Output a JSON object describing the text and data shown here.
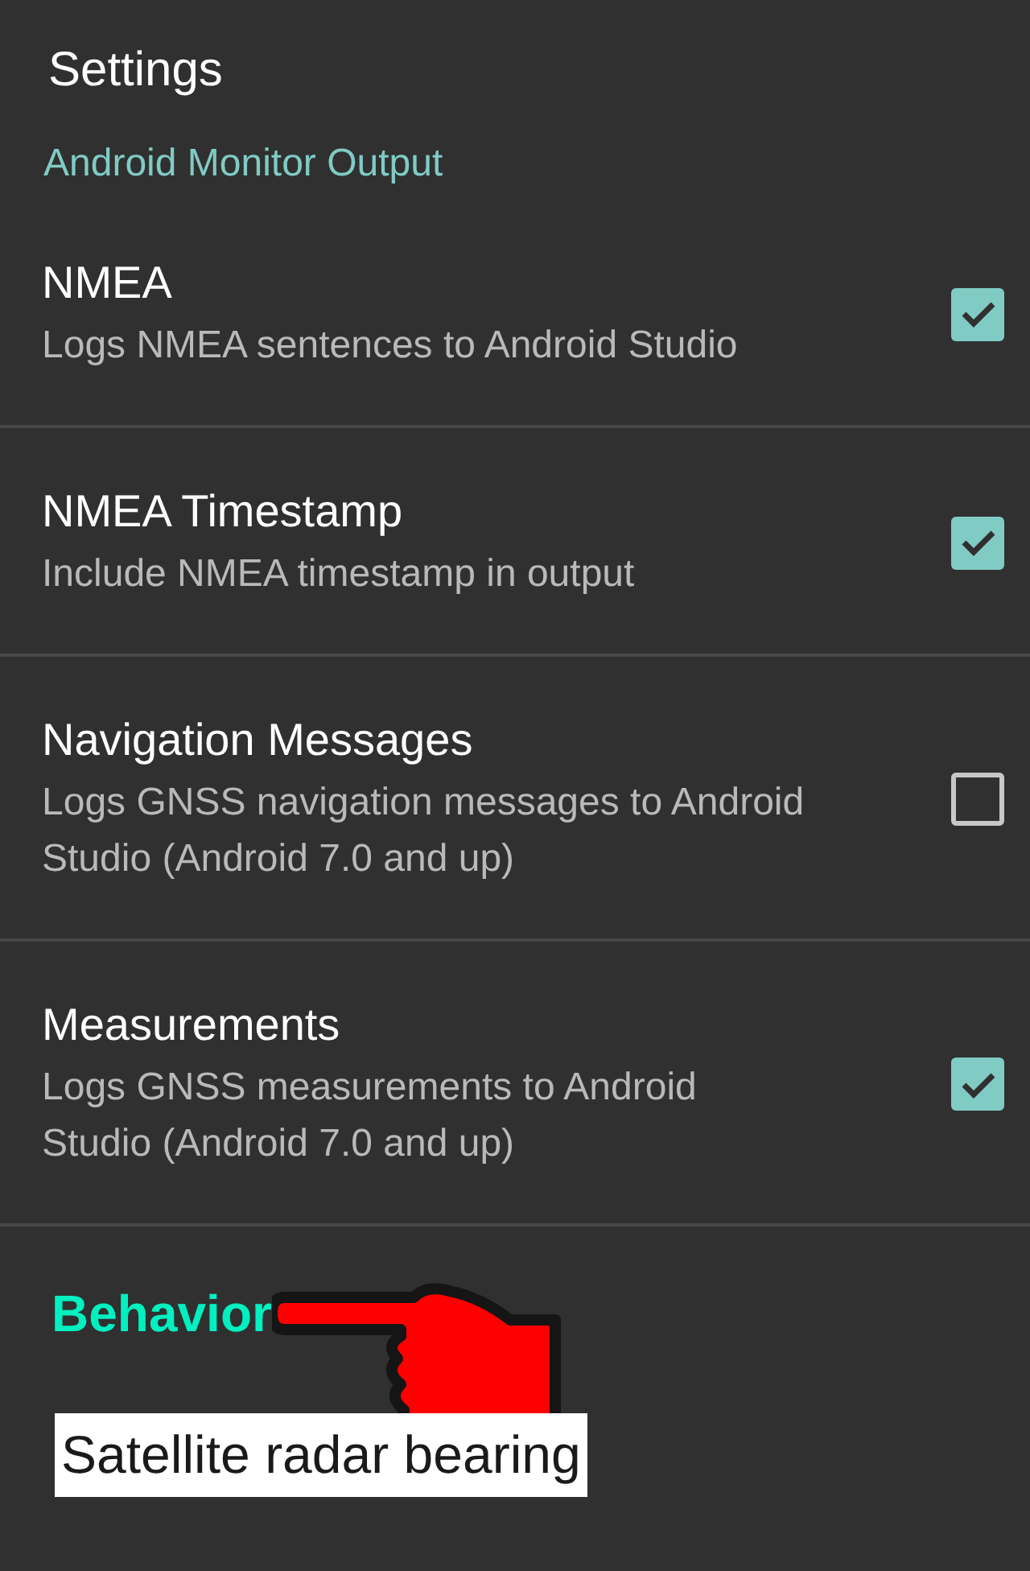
{
  "title": "Settings",
  "category": "Android Monitor Output",
  "preferences": [
    {
      "title": "NMEA",
      "summary": "Logs NMEA sentences to Android Studio",
      "checked": true
    },
    {
      "title": "NMEA Timestamp",
      "summary": "Include NMEA timestamp in output",
      "checked": true
    },
    {
      "title": "Navigation Messages",
      "summary": "Logs GNSS navigation messages to Android Studio (Android 7.0 and up)",
      "checked": false
    },
    {
      "title": "Measurements",
      "summary": "Logs GNSS measurements to Android Studio (Android 7.0 and up)",
      "checked": true
    }
  ],
  "annotation": {
    "heading": "Behavior",
    "caption": "Satellite radar bearing"
  }
}
